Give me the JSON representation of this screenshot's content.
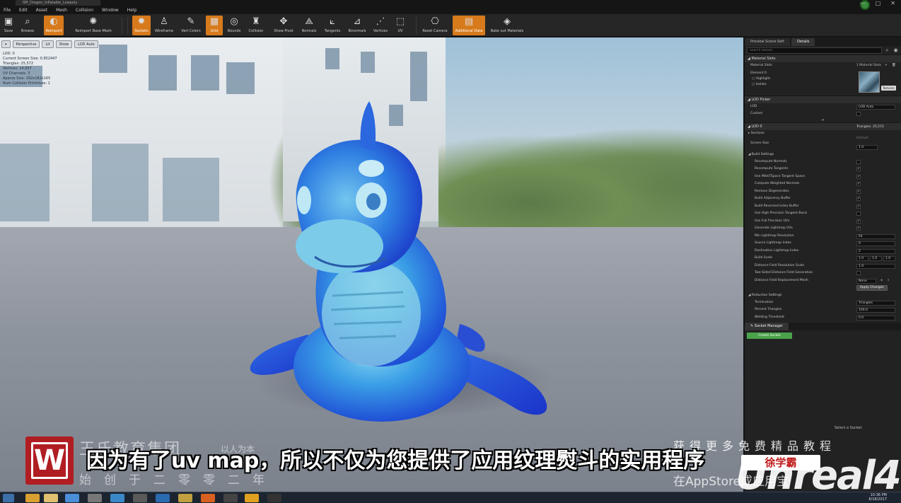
{
  "window": {
    "asset_tab": "SM_Dragon_Inflatable_Lowpoly",
    "menu": [
      "File",
      "Edit",
      "Asset",
      "Mesh",
      "Collision",
      "Window",
      "Help"
    ],
    "controls": [
      "—",
      "□",
      "✕"
    ]
  },
  "toolbar": {
    "buttons": [
      {
        "label": "Save",
        "icon": "save-icon",
        "active": false
      },
      {
        "label": "Browse",
        "icon": "browse-icon",
        "active": false
      },
      {
        "label": "Reimport",
        "icon": "reimport-icon",
        "active": true
      },
      {
        "label": "Reimport Base Mesh",
        "icon": "reimport-base-mesh-icon",
        "active": false
      },
      {
        "label": "Sockets",
        "icon": "sockets-icon",
        "active": true
      },
      {
        "label": "Wireframe",
        "icon": "wireframe-icon",
        "active": false
      },
      {
        "label": "Vert Colors",
        "icon": "vert-colors-icon",
        "active": false
      },
      {
        "label": "Grid",
        "icon": "grid-icon",
        "active": true
      },
      {
        "label": "Bounds",
        "icon": "bounds-icon",
        "active": false
      },
      {
        "label": "Collision",
        "icon": "collision-icon",
        "active": false
      },
      {
        "label": "Show Pivot",
        "icon": "pivot-icon",
        "active": false
      },
      {
        "label": "Normals",
        "icon": "normals-icon",
        "active": false
      },
      {
        "label": "Tangents",
        "icon": "tangents-icon",
        "active": false
      },
      {
        "label": "Binormals",
        "icon": "binormals-icon",
        "active": false
      },
      {
        "label": "Vertices",
        "icon": "vertices-icon",
        "active": false
      },
      {
        "label": "UV",
        "icon": "uv-icon",
        "active": false
      },
      {
        "label": "Reset Camera",
        "icon": "reset-camera-icon",
        "active": false
      },
      {
        "label": "Additional Data",
        "icon": "additional-data-icon",
        "active": true
      },
      {
        "label": "Bake out Materials",
        "icon": "bake-materials-icon",
        "active": false
      }
    ]
  },
  "viewport": {
    "controls": [
      "▾",
      "Perspective",
      "Lit",
      "Show",
      "LOD Auto"
    ],
    "info": [
      "LOD: 0",
      "Current Screen Size: 0.852447",
      "Triangles: 25,572",
      "Vertices: 14,957",
      "UV Channels: 3",
      "Approx Size: 292x182x165",
      "Num Collision Primitives: 1"
    ]
  },
  "details": {
    "tabs": [
      "Preview Scene Sett",
      "Details"
    ],
    "search_placeholder": "Search Details",
    "material_slots": {
      "header": "Material Slots",
      "label": "Material Slots",
      "count": "1 Material Slots",
      "element": "Element 0",
      "highlight": "Highlight",
      "isolate": "Isolate",
      "textures_btn": "Textures"
    },
    "lod_picker": {
      "header": "LOD Picker",
      "lod_label": "LOD",
      "lod_value": "LOD Auto",
      "custom_label": "Custom"
    },
    "lod0": {
      "header": "LOD 0",
      "triangles": "Triangles: 25,572",
      "sections": "Sections",
      "screen_size_label": "Screen Size",
      "screen_size_default": "Default",
      "screen_size_value": "1.0"
    },
    "build_settings": {
      "header": "Build Settings",
      "checks": [
        {
          "label": "Recompute Normals",
          "checked": false
        },
        {
          "label": "Recompute Tangents",
          "checked": true
        },
        {
          "label": "Use MikkTSpace Tangent Space",
          "checked": true
        },
        {
          "label": "Compute Weighted Normals",
          "checked": true
        },
        {
          "label": "Remove Degenerates",
          "checked": true
        },
        {
          "label": "Build Adjacency Buffer",
          "checked": true
        },
        {
          "label": "Build Reversed Index Buffer",
          "checked": true
        },
        {
          "label": "Use High Precision Tangent Basis",
          "checked": false
        },
        {
          "label": "Use Full Precision UVs",
          "checked": true
        },
        {
          "label": "Generate Lightmap UVs",
          "checked": true
        }
      ],
      "min_lightmap_label": "Min Lightmap Resolution",
      "min_lightmap_value": "64",
      "source_lightmap_label": "Source Lightmap Index",
      "source_lightmap_value": "0",
      "dest_lightmap_label": "Destination Lightmap Index",
      "dest_lightmap_value": "2",
      "build_scale_label": "Build Scale",
      "build_scale_values": [
        "1.0",
        "1.0",
        "1.0"
      ],
      "df_res_label": "Distance Field Resolution Scale",
      "df_res_value": "1.0",
      "two_sided_label": "Two-Sided Distance Field Generation",
      "df_replace_label": "Distance Field Replacement Mesh",
      "df_replace_value": "None",
      "apply_btn": "Apply Changes"
    },
    "reduction": {
      "header": "Reduction Settings",
      "termination_label": "Termination",
      "termination_value": "Triangles",
      "percent_label": "Percent Triangles",
      "percent_value": "100.0",
      "welding_label": "Welding Threshold",
      "welding_value": "0.0"
    }
  },
  "socket_manager": {
    "tab": "Socket Manager",
    "create_btn": "Create Socket",
    "select_text": "Select a Socket"
  },
  "overlay": {
    "logo_letter": "W",
    "org_name": "王氏教育集团",
    "org_slogan": "以人为本",
    "founded": "始创于二零零二年",
    "subtitle": "因为有了uv map，所以不仅为您提供了应用纹理熨斗的实用程序",
    "right_top": "获得更多免费精品教程",
    "right_bottom": "在AppStore或应用宝",
    "brand": "Unreal4",
    "badge": "徐学霸"
  },
  "taskbar": {
    "time": "10:36 PM",
    "date": "6/18/2017"
  }
}
